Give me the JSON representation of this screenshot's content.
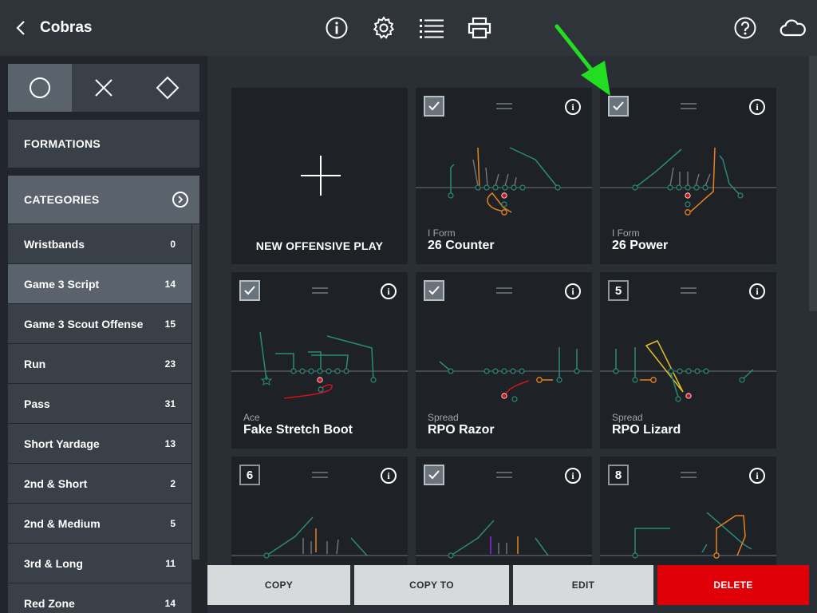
{
  "header": {
    "title": "Cobras",
    "icons": [
      "chevron-left-icon",
      "info-icon",
      "gear-icon",
      "list-icon",
      "printer-icon",
      "help-icon",
      "cloud-icon"
    ]
  },
  "sidebar": {
    "shape_tabs": [
      "circle",
      "x",
      "diamond"
    ],
    "formations_label": "FORMATIONS",
    "categories_label": "CATEGORIES",
    "categories": [
      {
        "label": "Wristbands",
        "count": "0"
      },
      {
        "label": "Game 3 Script",
        "count": "14"
      },
      {
        "label": "Game 3 Scout Offense",
        "count": "15"
      },
      {
        "label": "Run",
        "count": "23"
      },
      {
        "label": "Pass",
        "count": "31"
      },
      {
        "label": "Short Yardage",
        "count": "13"
      },
      {
        "label": "2nd & Short",
        "count": "2"
      },
      {
        "label": "2nd & Medium",
        "count": "5"
      },
      {
        "label": "3rd & Long",
        "count": "11"
      },
      {
        "label": "Red Zone",
        "count": "14"
      }
    ]
  },
  "new_play_label": "NEW OFFENSIVE PLAY",
  "plays": [
    {
      "formation": "I Form",
      "name": "26 Counter",
      "marker": ""
    },
    {
      "formation": "I Form",
      "name": "26 Power",
      "marker": ""
    },
    {
      "formation": "Ace",
      "name": "Fake Stretch Boot",
      "marker": ""
    },
    {
      "formation": "Spread",
      "name": "RPO Razor",
      "marker": ""
    },
    {
      "formation": "Spread",
      "name": "RPO Lizard",
      "marker": "5"
    },
    {
      "formation": "",
      "name": "",
      "marker": "6"
    },
    {
      "formation": "",
      "name": "",
      "marker": ""
    },
    {
      "formation": "",
      "name": "",
      "marker": "8"
    }
  ],
  "actions": {
    "copy": "COPY",
    "copy_to": "COPY TO",
    "edit": "EDIT",
    "delete": "DELETE"
  },
  "colors": {
    "route_teal": "#2a8a7a",
    "route_orange": "#e8821e",
    "route_red": "#d0141c",
    "route_yellow": "#e0c020",
    "route_purple": "#8a2be2",
    "delete_red": "#e00008",
    "annotation_green": "#22dd22"
  }
}
